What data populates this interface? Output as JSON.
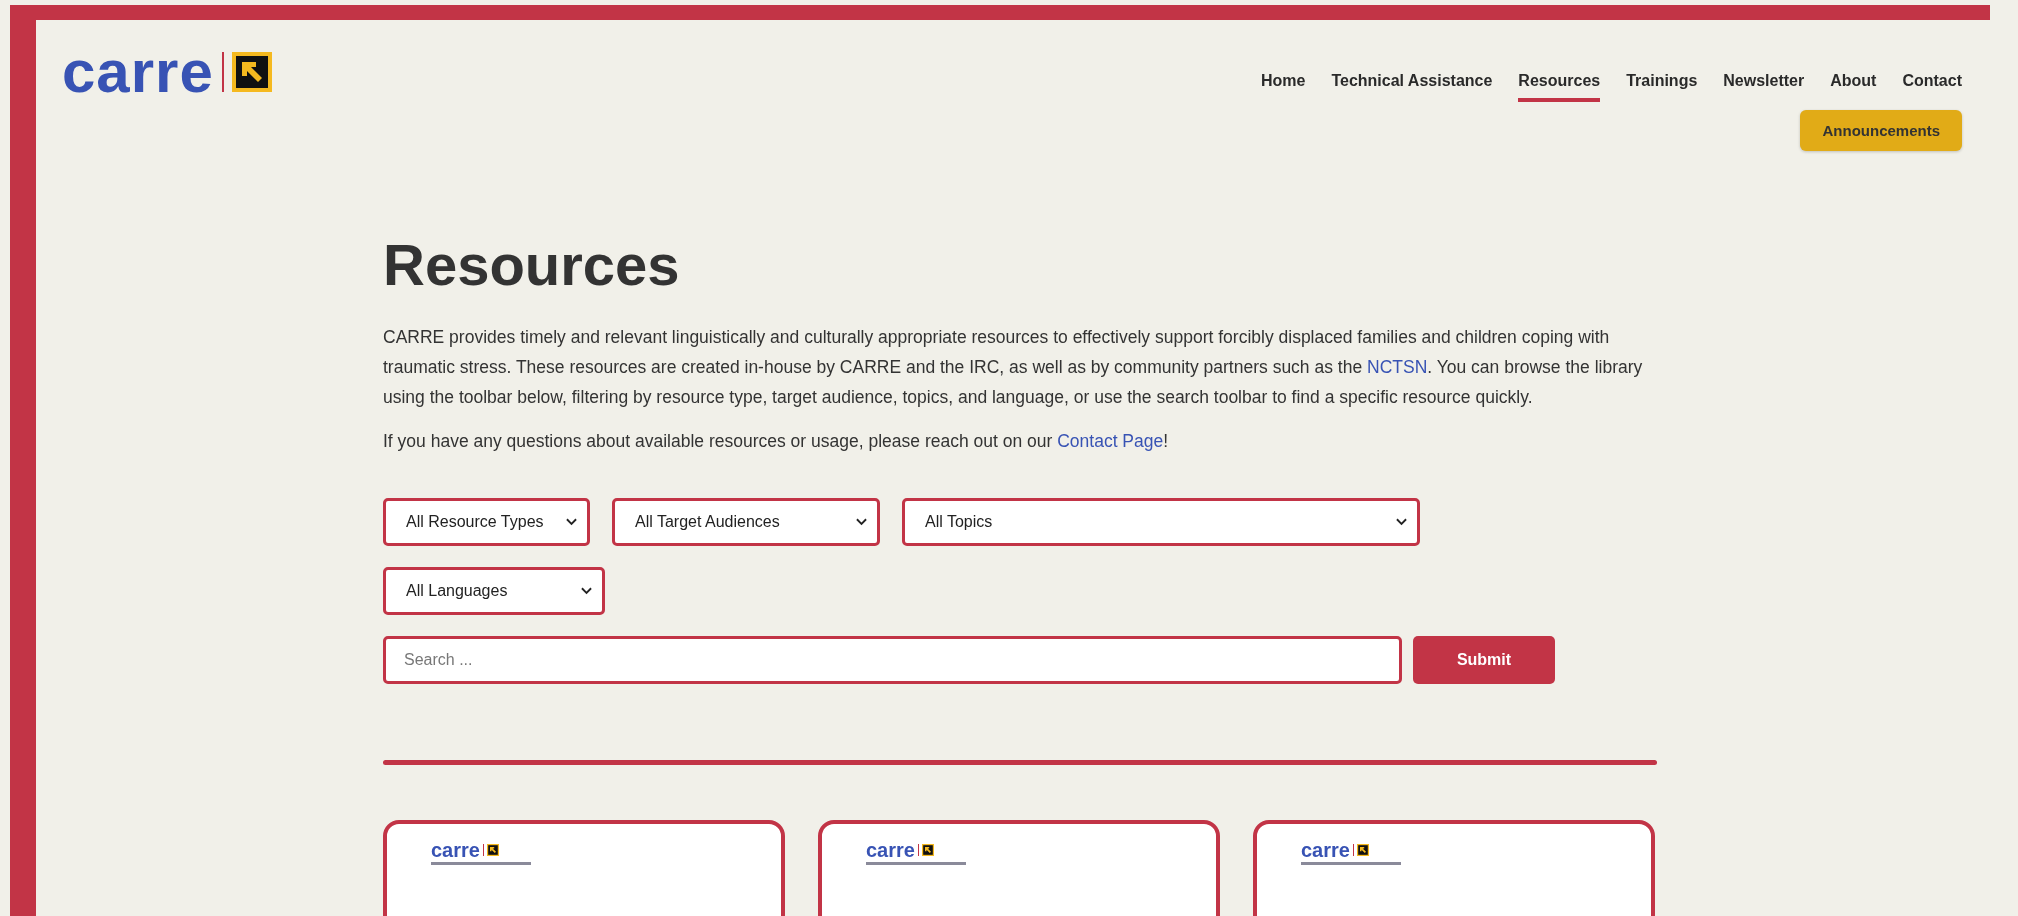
{
  "header": {
    "logo": "carre",
    "nav": [
      {
        "label": "Home",
        "selected": false
      },
      {
        "label": "Technical Assistance",
        "selected": false
      },
      {
        "label": "Resources",
        "selected": true
      },
      {
        "label": "Trainings",
        "selected": false
      },
      {
        "label": "Newsletter",
        "selected": false
      },
      {
        "label": "About",
        "selected": false
      },
      {
        "label": "Contact",
        "selected": false
      }
    ],
    "announcements_button": "Announcements"
  },
  "page": {
    "title": "Resources",
    "intro": [
      {
        "kind": "text",
        "text": "CARRE provides timely and relevant linguistically and culturally appropriate resources to effectively support forcibly displaced families and children coping with traumatic stress. These resources are created in-house by CARRE and the IRC, as well as by community partners such as the "
      },
      {
        "kind": "link",
        "text": "NCTSN"
      },
      {
        "kind": "text",
        "text": ".  You can browse the library using the toolbar below, filtering by resource type, target audience, topics, and language, or use the search toolbar to find a specific resource quickly."
      }
    ],
    "contact_note": [
      {
        "kind": "text",
        "text": "If you have any questions about available resources or usage, please reach out on our "
      },
      {
        "kind": "link",
        "text": "Contact Page"
      },
      {
        "kind": "text",
        "text": "!"
      }
    ]
  },
  "filters": [
    {
      "value": "All Resource Types"
    },
    {
      "value": "All Target Audiences"
    },
    {
      "value": "All Topics"
    },
    {
      "value": "All Languages"
    }
  ],
  "search": {
    "placeholder": "Search ...",
    "button": "Submit"
  },
  "cards": [
    {
      "logo": "carre"
    },
    {
      "logo": "carre"
    },
    {
      "logo": "carre"
    }
  ]
}
